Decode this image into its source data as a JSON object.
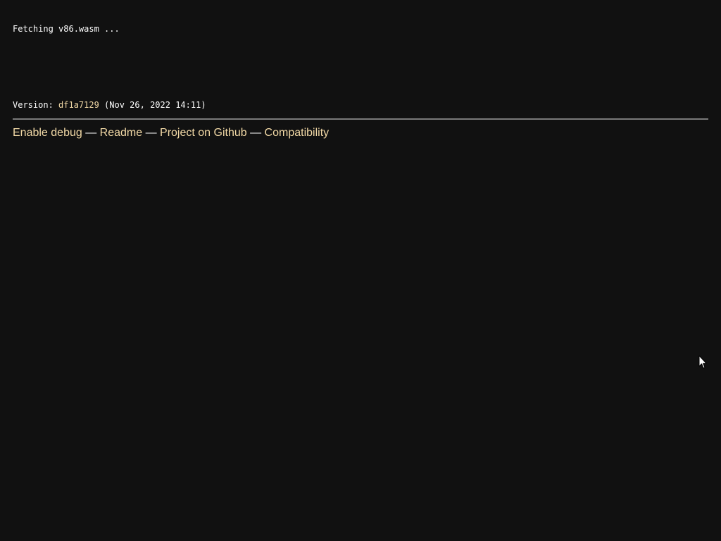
{
  "status": {
    "message": "Fetching v86.wasm ..."
  },
  "version": {
    "label": "Version: ",
    "hash": "df1a7129",
    "date": " (Nov 26, 2022 14:11)"
  },
  "footer_links": {
    "enable_debug": "Enable debug",
    "readme": "Readme",
    "github": "Project on Github",
    "compatibility": "Compatibility",
    "separator": " — "
  },
  "colors": {
    "background": "#111111",
    "text": "#ffffff",
    "link": "#f2d9a6",
    "divider": "#7a7a7a"
  },
  "icons": {
    "cursor": "mouse-pointer-icon"
  }
}
